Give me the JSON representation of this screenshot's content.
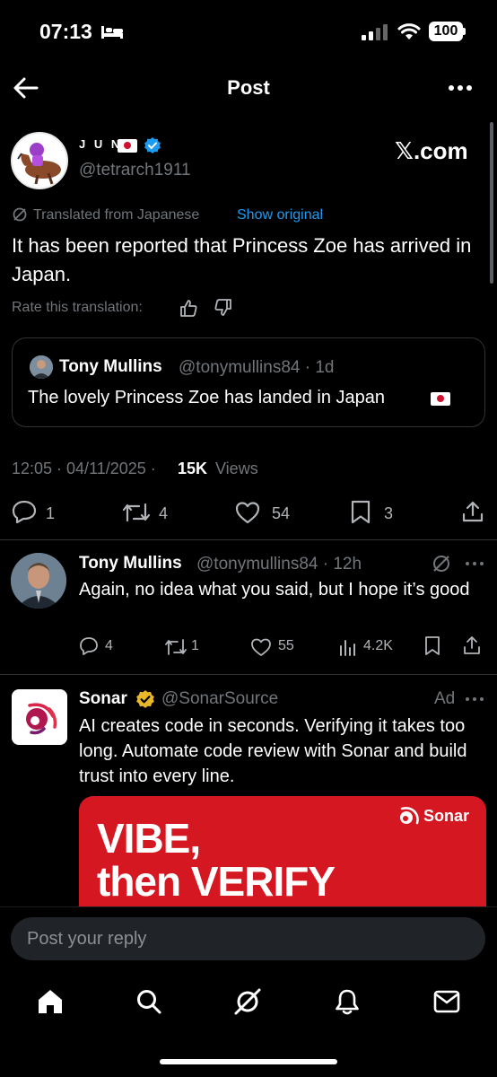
{
  "status_bar": {
    "time": "07:13",
    "battery": "100"
  },
  "nav": {
    "title": "Post"
  },
  "main_post": {
    "author_name": "J U N",
    "author_handle": "@tetrarch1911",
    "source_brand": "𝕏.com",
    "translated_label": "Translated from Japanese",
    "show_original": "Show original",
    "text": "It has been reported that Princess Zoe has arrived in Japan.",
    "rate_label": "Rate this translation:",
    "quote": {
      "name": "Tony Mullins",
      "handle_time": "@tonymullins84 · 1d",
      "text": "The lovely Princess Zoe has landed in Japan"
    },
    "timestamp": "12:05 · 04/11/2025 ·",
    "views_count": "15K",
    "views_label": "Views",
    "stats": {
      "replies": "1",
      "reposts": "4",
      "likes": "54",
      "bookmarks": "3"
    }
  },
  "reply": {
    "name": "Tony Mullins",
    "handle_time": "@tonymullins84 · 12h",
    "text": "Again, no idea what you said, but I hope it’s good",
    "stats": {
      "replies": "4",
      "reposts": "1",
      "likes": "55",
      "views": "4.2K"
    }
  },
  "ad": {
    "name": "Sonar",
    "handle": "@SonarSource",
    "label": "Ad",
    "text": "AI creates code in seconds. Verifying it takes too long. Automate code review with Sonar and build trust into every line.",
    "banner_line1": "VIBE,",
    "banner_line2": "then VERIFY",
    "banner_brand": "Sonar"
  },
  "reply_bar": {
    "placeholder": "Post your reply"
  },
  "colors": {
    "accent": "#1d9bf0",
    "verified_blue": "#1d9bf0",
    "verified_gold": "#e8b829",
    "sonar_red": "#d41720"
  }
}
